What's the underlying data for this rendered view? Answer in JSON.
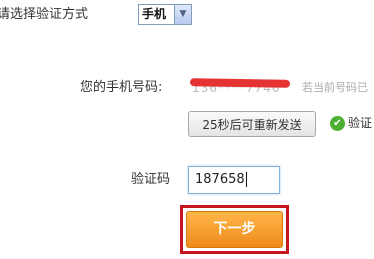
{
  "verify_method": {
    "label": "请选择验证方式",
    "selected": "手机",
    "arrow_icon": "chevron-down-icon"
  },
  "phone": {
    "label": "您的手机号码:",
    "masked_value": "136****7746",
    "note": "若当前号码已"
  },
  "resend": {
    "button_label": "25秒后可重新发送",
    "status_text": "验证",
    "status_icon": "check-circle-icon",
    "status_color": "#4caf32"
  },
  "code": {
    "label": "验证码",
    "value": "187658"
  },
  "next": {
    "button_label": "下一步",
    "button_color": "#f19a28",
    "highlight_color": "#c4161c"
  }
}
